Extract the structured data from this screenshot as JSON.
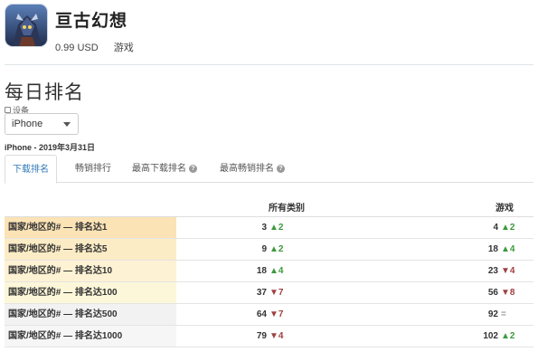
{
  "app": {
    "title": "亘古幻想",
    "price": "0.99 USD",
    "category": "游戏"
  },
  "section": {
    "title": "每日排名",
    "device_label": "设备",
    "device_value": "iPhone",
    "date_line": "iPhone - 2019年3月31日"
  },
  "tabs": [
    {
      "label": "下载排名",
      "active": true,
      "help": false
    },
    {
      "label": "畅销排行",
      "active": false,
      "help": false
    },
    {
      "label": "最高下载排名",
      "active": false,
      "help": true
    },
    {
      "label": "最高畅销排名",
      "active": false,
      "help": true
    }
  ],
  "table": {
    "headers": [
      "所有类别",
      "游戏"
    ],
    "rows": [
      {
        "label": "国家/地区的# — 排名达1",
        "all": "3",
        "all_delta": "2",
        "all_dir": "up",
        "game": "4",
        "game_delta": "2",
        "game_dir": "up",
        "color": "#fbe3b6"
      },
      {
        "label": "国家/地区的# — 排名达5",
        "all": "9",
        "all_delta": "2",
        "all_dir": "up",
        "game": "18",
        "game_delta": "4",
        "game_dir": "up",
        "color": "#fcecc5"
      },
      {
        "label": "国家/地区的# — 排名达10",
        "all": "18",
        "all_delta": "4",
        "all_dir": "up",
        "game": "23",
        "game_delta": "4",
        "game_dir": "down",
        "color": "#fdf2d3"
      },
      {
        "label": "国家/地区的# — 排名达100",
        "all": "37",
        "all_delta": "7",
        "all_dir": "down",
        "game": "56",
        "game_delta": "8",
        "game_dir": "down",
        "color": "#fcf7d9"
      },
      {
        "label": "国家/地区的# — 排名达500",
        "all": "64",
        "all_delta": "7",
        "all_dir": "down",
        "game": "92",
        "game_delta": "=",
        "game_dir": "flat",
        "color": "#f2f2f2"
      },
      {
        "label": "国家/地区的# — 排名达1000",
        "all": "79",
        "all_delta": "4",
        "all_dir": "down",
        "game": "102",
        "game_delta": "2",
        "game_dir": "up",
        "color": "#f6f6f6"
      }
    ]
  }
}
